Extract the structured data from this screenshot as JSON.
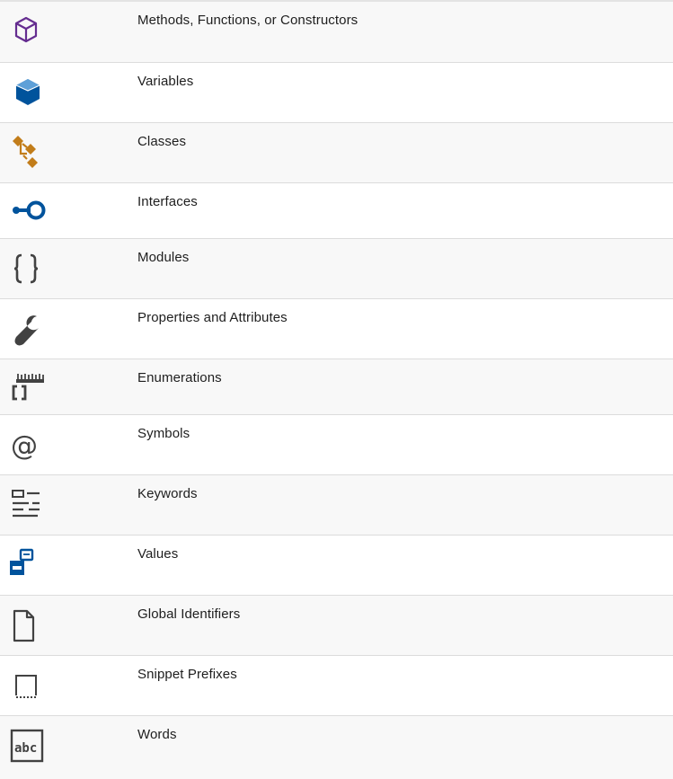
{
  "rows": [
    {
      "label": "Methods, Functions, or Constructors",
      "icon": "cube-outline-icon",
      "color": "#652d90"
    },
    {
      "label": "Variables",
      "icon": "cube-solid-icon",
      "color": "#00539c"
    },
    {
      "label": "Classes",
      "icon": "class-tree-icon",
      "color": "#c27d1a"
    },
    {
      "label": "Interfaces",
      "icon": "interface-lollipop-icon",
      "color": "#00539c"
    },
    {
      "label": "Modules",
      "icon": "braces-icon",
      "color": "#424242"
    },
    {
      "label": "Properties and Attributes",
      "icon": "wrench-icon",
      "color": "#424242"
    },
    {
      "label": "Enumerations",
      "icon": "ruler-brackets-icon",
      "color": "#424242"
    },
    {
      "label": "Symbols",
      "icon": "at-sign-icon",
      "color": "#424242"
    },
    {
      "label": "Keywords",
      "icon": "keyword-lines-icon",
      "color": "#424242"
    },
    {
      "label": "Values",
      "icon": "value-blocks-icon",
      "color": "#00539c"
    },
    {
      "label": "Global Identifiers",
      "icon": "document-icon",
      "color": "#424242"
    },
    {
      "label": "Snippet Prefixes",
      "icon": "snippet-box-icon",
      "color": "#424242"
    },
    {
      "label": "Words",
      "icon": "abc-box-icon",
      "color": "#424242"
    }
  ]
}
